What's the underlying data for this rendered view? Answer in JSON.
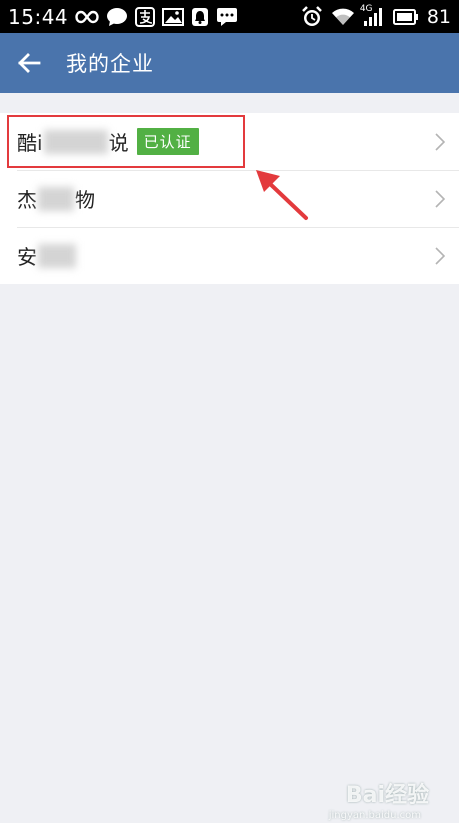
{
  "status_bar": {
    "time": "15:44",
    "battery": "81",
    "network": "4G",
    "icons": [
      "infinity-icon",
      "chat-bubble-icon",
      "alipay-icon",
      "image-icon",
      "bell-icon",
      "message-icon",
      "alarm-icon",
      "wifi-icon",
      "signal-icon",
      "battery-icon"
    ]
  },
  "header": {
    "title": "我的企业",
    "background": "#4a74ac"
  },
  "companies": [
    {
      "prefix": "酷i",
      "suffix": "说",
      "badge": "已认证"
    },
    {
      "prefix": "杰",
      "suffix": "物"
    },
    {
      "prefix": "安",
      "suffix": ""
    }
  ],
  "annotation": {
    "color": "#e33a3d"
  },
  "watermark": {
    "text": "Bai经验",
    "sub": "jingyan.baidu.com"
  },
  "colors": {
    "badge": "#52b044",
    "background": "#eff0f4"
  }
}
